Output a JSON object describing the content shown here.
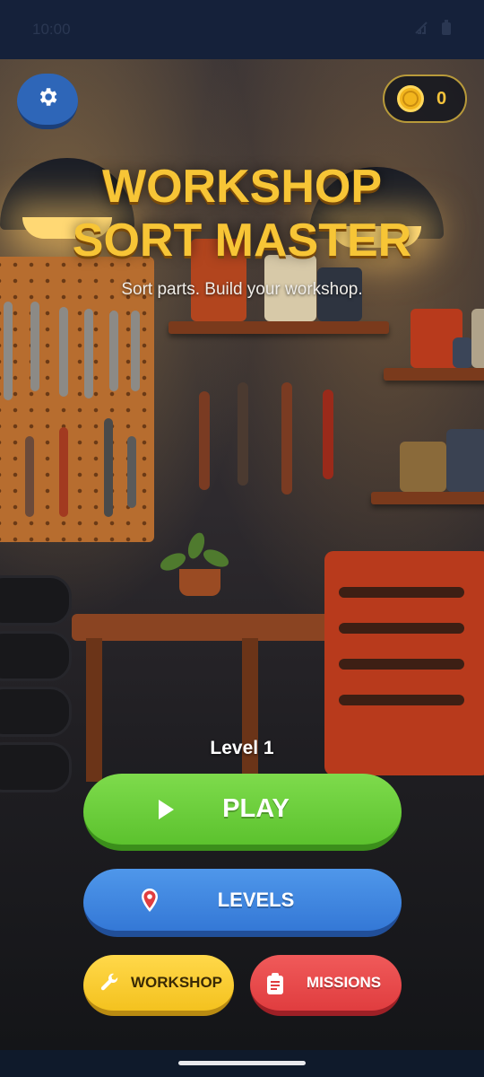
{
  "status_bar": {
    "time": "10:00",
    "icons": [
      "signal-off-icon",
      "battery-icon"
    ]
  },
  "header": {
    "settings_icon": "gear-icon",
    "coins": "0",
    "coin_icon": "coin-icon"
  },
  "title": {
    "line1": "WORKSHOP",
    "line2": "SORT MASTER",
    "subtitle": "Sort parts. Build your workshop."
  },
  "level": {
    "label": "Level 1"
  },
  "buttons": {
    "play": {
      "label": "PLAY",
      "icon": "play-icon",
      "color": "#5cc22e"
    },
    "levels": {
      "label": "LEVELS",
      "icon": "map-pin-icon",
      "color": "#3478d6"
    },
    "workshop": {
      "label": "WORKSHOP",
      "icon": "wrench-icon",
      "color": "#f4c21f"
    },
    "missions": {
      "label": "MISSIONS",
      "icon": "clipboard-icon",
      "color": "#e03d3f"
    }
  },
  "colors": {
    "title": "#f7c536",
    "background": "#15213a"
  }
}
